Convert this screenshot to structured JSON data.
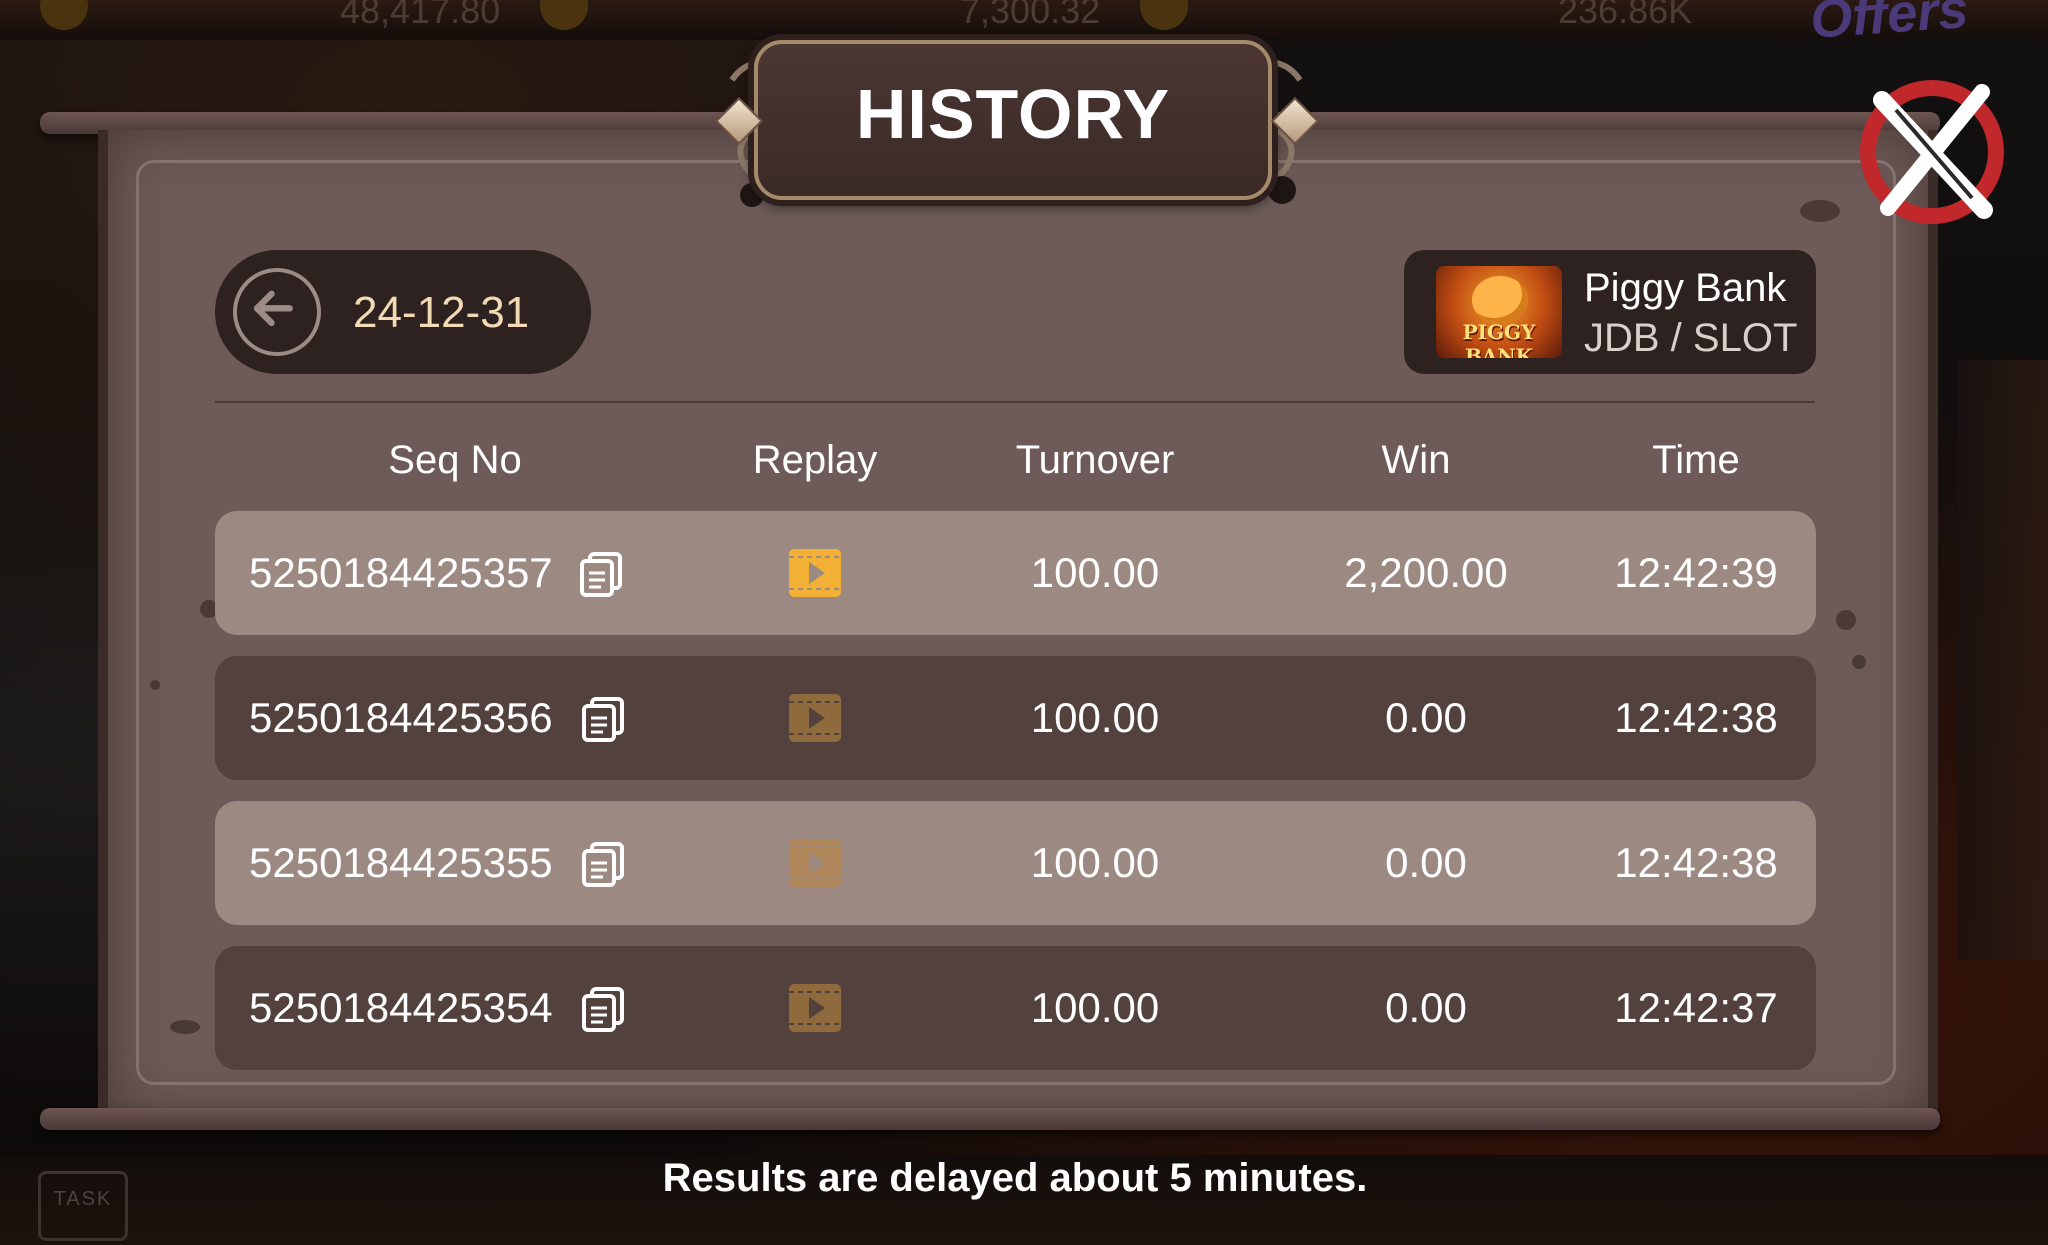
{
  "background": {
    "top_numbers": [
      "48,417.80",
      "7,300.32",
      "236.86K"
    ],
    "offers_label": "Offers",
    "task_label": "TASK"
  },
  "dialog": {
    "title": "HISTORY",
    "date": "24-12-31",
    "game": {
      "name": "Piggy Bank",
      "provider": "JDB / SLOT",
      "thumb_label": "PIGGY BANK"
    },
    "columns": [
      "Seq No",
      "Replay",
      "Turnover",
      "Win",
      "Time"
    ],
    "rows": [
      {
        "seq": "5250184425357",
        "turnover": "100.00",
        "win": "2,200.00",
        "time": "12:42:39",
        "replay_state": "active"
      },
      {
        "seq": "5250184425356",
        "turnover": "100.00",
        "win": "0.00",
        "time": "12:42:38",
        "replay_state": "muted"
      },
      {
        "seq": "5250184425355",
        "turnover": "100.00",
        "win": "0.00",
        "time": "12:42:38",
        "replay_state": "muted"
      },
      {
        "seq": "5250184425354",
        "turnover": "100.00",
        "win": "0.00",
        "time": "12:42:37",
        "replay_state": "muted"
      }
    ],
    "footer_note": "Results are delayed about 5 minutes."
  },
  "colors": {
    "panel": "#6e5b59",
    "row_light": "#9c8982",
    "row_dark": "#52413d",
    "replay_active": "#f2b134",
    "replay_muted": "#8e6a3c",
    "date_text": "#f3d9b4",
    "close_red": "#c0282b"
  },
  "icons": {
    "back": "arrow-left-circle-icon",
    "copy": "copy-document-icon",
    "replay": "film-play-icon",
    "close": "brush-x-close-icon"
  }
}
